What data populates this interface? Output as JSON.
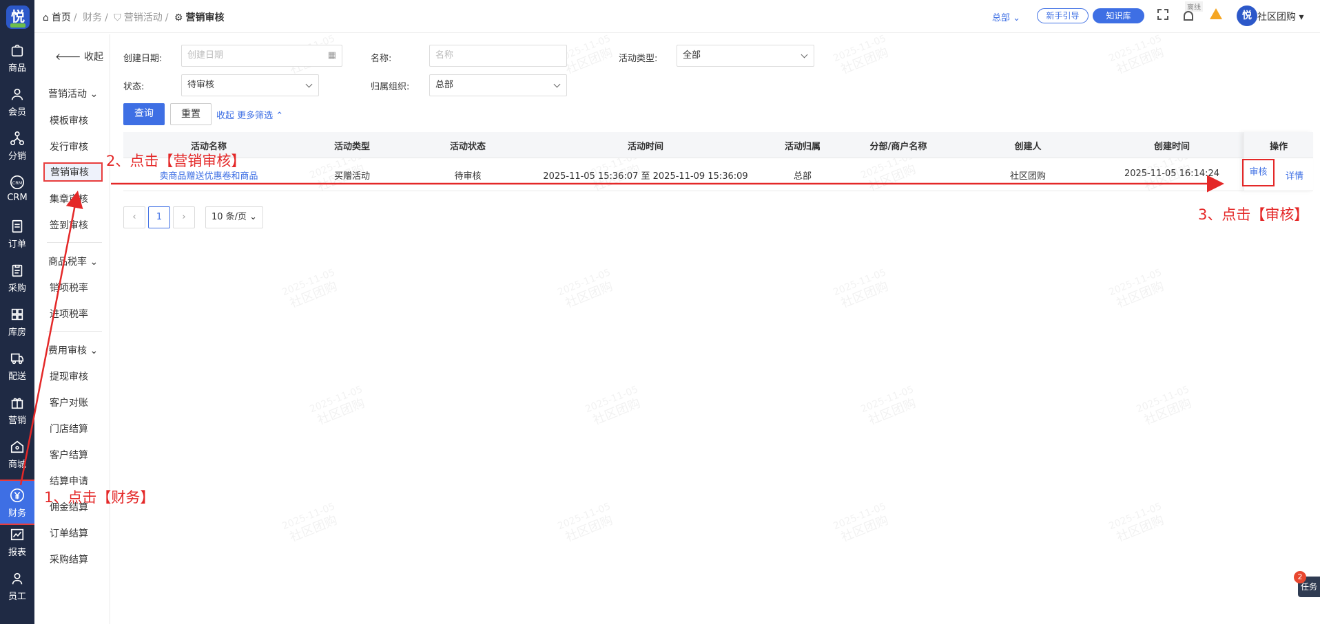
{
  "watermark": {
    "date": "2025-11-05",
    "org": "社区团购"
  },
  "rail": {
    "logo": "悦",
    "items": [
      {
        "label": "商品",
        "icon": "bag-icon"
      },
      {
        "label": "会员",
        "icon": "user-icon"
      },
      {
        "label": "分销",
        "icon": "network-icon"
      },
      {
        "label": "CRM",
        "icon": "crm-icon"
      },
      {
        "label": "订单",
        "icon": "order-icon"
      },
      {
        "label": "采购",
        "icon": "clipboard-icon"
      },
      {
        "label": "库房",
        "icon": "grid-icon"
      },
      {
        "label": "配送",
        "icon": "truck-icon"
      },
      {
        "label": "营销",
        "icon": "gift-icon"
      },
      {
        "label": "商城",
        "icon": "home-icon"
      },
      {
        "label": "财务",
        "icon": "yen-icon"
      },
      {
        "label": "报表",
        "icon": "chart-icon"
      },
      {
        "label": "员工",
        "icon": "staff-icon"
      }
    ]
  },
  "submenu": {
    "collapse": "收起",
    "groups": [
      {
        "title": "营销活动",
        "items": [
          "模板审核",
          "发行审核",
          "营销审核",
          "集章审核",
          "签到审核"
        ]
      },
      {
        "title": "商品税率",
        "items": [
          "销项税率",
          "进项税率"
        ]
      },
      {
        "title": "费用审核",
        "items": [
          "提现审核",
          "客户对账",
          "门店结算",
          "客户结算",
          "结算申请",
          "佣金结算",
          "订单结算",
          "采购结算"
        ]
      }
    ],
    "active": "营销审核"
  },
  "header": {
    "breadcrumb": [
      "首页",
      "财务",
      "营销活动",
      "营销审核"
    ],
    "org": "总部",
    "guide": "新手引导",
    "kb": "知识库",
    "offline": "离线",
    "user": "社区团购"
  },
  "filters": {
    "created_date": {
      "label": "创建日期:",
      "placeholder": "创建日期"
    },
    "name": {
      "label": "名称:",
      "placeholder": "名称"
    },
    "activity_type": {
      "label": "活动类型:",
      "value": "全部"
    },
    "status": {
      "label": "状态:",
      "value": "待审核"
    },
    "org": {
      "label": "归属组织:",
      "value": "总部"
    },
    "query": "查询",
    "reset": "重置",
    "toggle": "收起 更多筛选"
  },
  "table": {
    "columns": [
      "活动名称",
      "活动类型",
      "活动状态",
      "活动时间",
      "活动归属",
      "分部/商户名称",
      "创建人",
      "创建时间",
      "操作"
    ],
    "rows": [
      {
        "name": "卖商品赠送优惠卷和商品",
        "type": "买赠活动",
        "status": "待审核",
        "time": "2025-11-05 15:36:07 至 2025-11-09 15:36:09",
        "owner": "总部",
        "branch": "",
        "creator": "社区团购",
        "created": "2025-11-05 16:14:24",
        "audit": "审核",
        "detail": "详情"
      }
    ]
  },
  "pagination": {
    "page": "1",
    "page_size": "10 条/页"
  },
  "annotations": {
    "step1": "1、点击【财务】",
    "step2": "2、点击【营销审核】",
    "step3": "3、点击【审核】"
  },
  "task": {
    "label": "任务",
    "count": "2"
  },
  "colors": {
    "primary": "#3e6fe4",
    "annotation": "#e42828",
    "rail": "#1f2a44"
  }
}
